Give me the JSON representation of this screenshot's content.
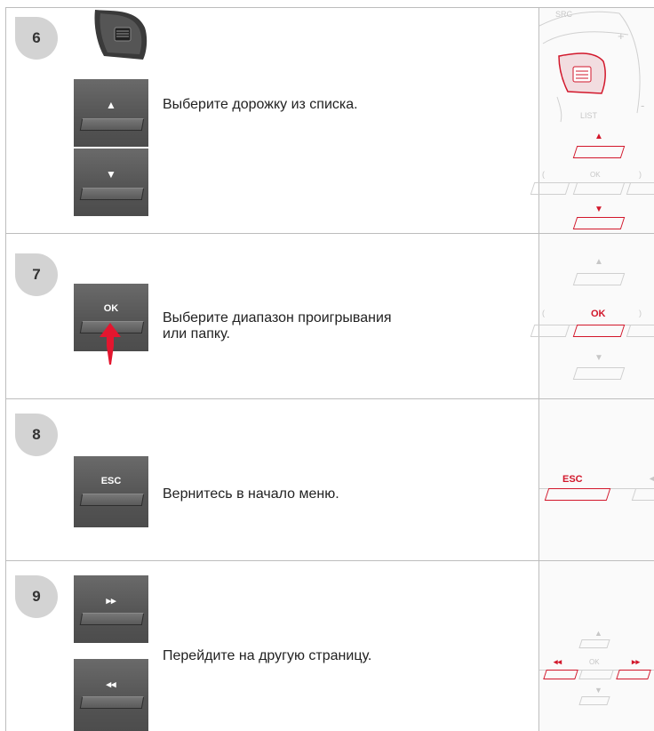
{
  "steps": [
    {
      "number": "6",
      "description": "Выберите дорожку из списка.",
      "buttons": [
        "▲",
        "▼"
      ],
      "panel": {
        "src": "SRC",
        "plus": "+",
        "minus": "-",
        "list": "LIST",
        "ok": "OK",
        "up": "▲",
        "down": "▼"
      }
    },
    {
      "number": "7",
      "description_line1": "Выберите диапазон проигрывания",
      "description_line2": "или папку.",
      "buttons": [
        "OK"
      ],
      "panel": {
        "up": "▲",
        "ok": "OK",
        "down": "▼"
      }
    },
    {
      "number": "8",
      "description": "Вернитесь в начало меню.",
      "buttons": [
        "ESC"
      ],
      "panel": {
        "esc": "ESC",
        "left": "◄"
      }
    },
    {
      "number": "9",
      "description": "Перейдите на другую страницу.",
      "buttons": [
        "▸▸",
        "◂◂"
      ],
      "panel": {
        "up": "▲",
        "ok": "OK",
        "down": "▼",
        "rew": "◂◂",
        "fwd": "▸▸"
      }
    }
  ],
  "colors": {
    "accent_red": "#d2172b",
    "badge_gray": "#d3d3d3",
    "button_gray": "#5c5c5c"
  },
  "icons": [
    "scroll-wheel-icon",
    "push-down-arrow-icon"
  ]
}
